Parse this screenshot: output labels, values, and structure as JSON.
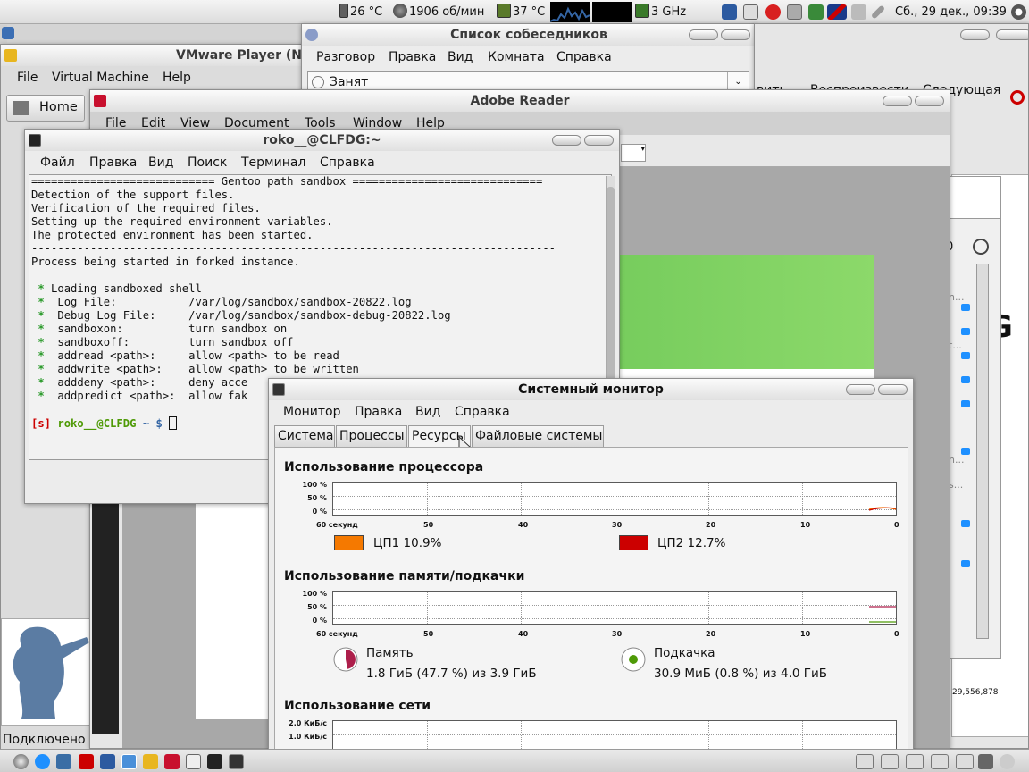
{
  "top_panel": {
    "cpu_temp": "26 °C",
    "fan_speed": "1906 об/мин",
    "gpu_temp": "37 °C",
    "cpu_freq": "3 GHz",
    "clock": "Сб., 29 дек., 09:39",
    "icons": [
      "thermometer-icon",
      "fan-icon",
      "chip-icon",
      "cpu-icon",
      "music-note-icon",
      "mail-icon",
      "stop-icon",
      "network-icon",
      "uk-flag-icon",
      "volume-icon",
      "brightness-icon",
      "power-icon"
    ]
  },
  "vmware": {
    "title": "VMware Player (Non",
    "menu": [
      "File",
      "Virtual Machine",
      "Help"
    ],
    "home_label": "Home",
    "status": "Подключено"
  },
  "pidgin": {
    "title": "Список собеседников",
    "menu": [
      "Разговор",
      "Правка",
      "Вид",
      "Комната",
      "Справка"
    ],
    "status_value": "Занят"
  },
  "media": {
    "menu_fragments": [
      "вить",
      "Воспроизвести",
      "Следующая"
    ],
    "big_letter": "G",
    "count": "29,556,878",
    "partial_text": [
      "n...",
      "t...",
      "n...",
      "s...",
      "0"
    ]
  },
  "adobe": {
    "title": "Adobe Reader",
    "menu": [
      "File",
      "Edit",
      "View",
      "Document",
      "Tools",
      "Window",
      "Help"
    ]
  },
  "terminal": {
    "title": "roko__@CLFDG:~",
    "menu": [
      "Файл",
      "Правка",
      "Вид",
      "Поиск",
      "Терминал",
      "Справка"
    ],
    "lines": [
      "============================ Gentoo path sandbox =============================",
      "Detection of the support files.",
      "Verification of the required files.",
      "Setting up the required environment variables.",
      "The protected environment has been started.",
      "--------------------------------------------------------------------------------",
      "Process being started in forked instance.",
      ""
    ],
    "star_lines": [
      "Loading sandboxed shell",
      " Log File:           /var/log/sandbox/sandbox-20822.log",
      " Debug Log File:     /var/log/sandbox/sandbox-debug-20822.log",
      " sandboxon:          turn sandbox on",
      " sandboxoff:         turn sandbox off",
      " addread <path>:     allow <path> to be read",
      " addwrite <path>:    allow <path> to be written",
      " adddeny <path>:     deny acce",
      " addpredict <path>:  allow fak"
    ],
    "prompt": {
      "flag": "[s]",
      "user_host": "roko__@CLFDG",
      "path": "~",
      "symbol": "$"
    }
  },
  "sysmon": {
    "title": "Системный монитор",
    "menu": [
      "Монитор",
      "Правка",
      "Вид",
      "Справка"
    ],
    "tabs": [
      "Система",
      "Процессы",
      "Ресурсы",
      "Файловые системы"
    ],
    "selected_tab": "Ресурсы",
    "cpu": {
      "heading": "Использование процессора",
      "cpu1_label": "ЦП1",
      "cpu1_value": "10.9%",
      "cpu1_color": "#f57900",
      "cpu2_label": "ЦП2",
      "cpu2_value": "12.7%",
      "cpu2_color": "#cc0000"
    },
    "memory": {
      "heading": "Использование памяти/подкачки",
      "mem_label": "Память",
      "mem_value": "1.8 ГиБ (47.7 %) из 3.9 ГиБ",
      "mem_color": "#ad1f4b",
      "swap_label": "Подкачка",
      "swap_value": "30.9 МиБ (0.8 %) из 4.0 ГиБ",
      "swap_color": "#4e9a06"
    },
    "network": {
      "heading": "Использование сети",
      "y_ticks": [
        "2.0 КиБ/с",
        "1.0 КиБ/с"
      ]
    },
    "chart_y_ticks": [
      "100 %",
      "50 %",
      "0 %"
    ],
    "chart_x_ticks": [
      "60 секунд",
      "50",
      "40",
      "30",
      "20",
      "10",
      "0"
    ]
  }
}
